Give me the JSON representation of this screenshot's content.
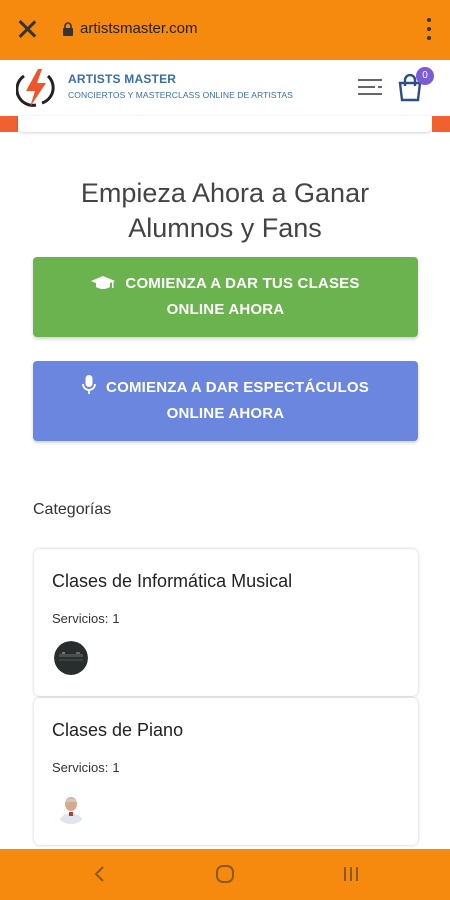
{
  "browser": {
    "url": "artistsmaster.com",
    "close_icon": "close-icon",
    "lock_icon": "lock-icon",
    "menu_icon": "more-vert-icon"
  },
  "header": {
    "brand_title": "ARTISTS MASTER",
    "brand_subtitle": "CONCIERTOS Y MASTERCLASS ONLINE DE ARTISTAS",
    "cart_count": "0",
    "colors": {
      "brand": "#3a6ea5",
      "badge": "#7c5cd6"
    }
  },
  "hero": {
    "title_line1": "Empieza Ahora a Ganar",
    "title_line2": "Alumnos y Fans"
  },
  "cta": {
    "classes_line1": "COMIENZA A DAR TUS CLASES",
    "classes_line2": "ONLINE AHORA",
    "shows_line1": "COMIENZA A DAR ESPECTÁCULOS",
    "shows_line2": "ONLINE AHORA",
    "colors": {
      "classes": "#6bb34e",
      "shows": "#6b86de"
    }
  },
  "categories": {
    "heading": "Categorías",
    "items": [
      {
        "title": "Clases de Informática Musical",
        "services_label": "Servicios:",
        "services_count": "1"
      },
      {
        "title": "Clases de Piano",
        "services_label": "Servicios:",
        "services_count": "1"
      }
    ]
  },
  "theme": {
    "accent": "#f58a0e",
    "strip": "#f0612f"
  }
}
